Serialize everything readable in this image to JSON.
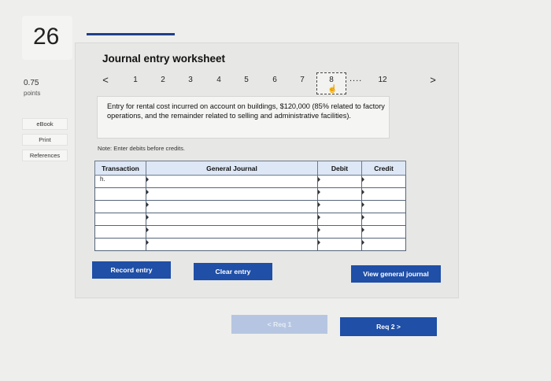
{
  "question": {
    "number": "26",
    "points_value": "0.75",
    "points_label": "points"
  },
  "side_links": [
    "eBook",
    "Print",
    "References"
  ],
  "worksheet": {
    "title": "Journal entry worksheet",
    "pager": {
      "prev": "<",
      "pages": [
        "1",
        "2",
        "3",
        "4",
        "5",
        "6",
        "7"
      ],
      "current": "8",
      "dots": "....",
      "last": "12",
      "next": ">"
    },
    "prompt": "Entry for rental cost incurred on account on buildings, $120,000 (85% related to factory operations, and the remainder related to selling and administrative facilities).",
    "note": "Note: Enter debits before credits.",
    "table": {
      "headers": {
        "transaction": "Transaction",
        "general_journal": "General Journal",
        "debit": "Debit",
        "credit": "Credit"
      },
      "rows": [
        {
          "transaction": "h."
        },
        {
          "transaction": ""
        },
        {
          "transaction": ""
        },
        {
          "transaction": ""
        },
        {
          "transaction": ""
        },
        {
          "transaction": ""
        }
      ]
    },
    "buttons": {
      "record": "Record entry",
      "clear": "Clear entry",
      "view": "View general journal"
    }
  },
  "nav": {
    "prev": "< Req 1",
    "next": "Req 2 >"
  },
  "colors": {
    "accent": "#1f4fa6",
    "header_bg": "#dde7f5",
    "disabled": "#b6c6e2"
  }
}
